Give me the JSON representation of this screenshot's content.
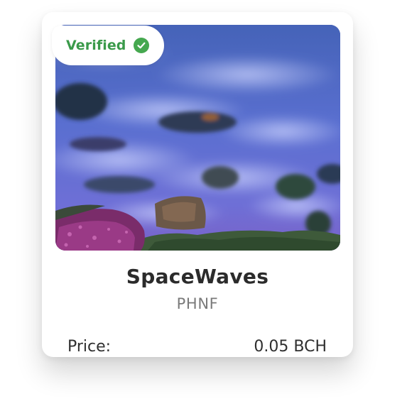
{
  "nft_card": {
    "badge": {
      "label": "Verified",
      "icon": "check-circle-icon",
      "color": "#45a84f"
    },
    "image": {
      "subject": "long-exposure surf over rocks, violet-blue tones"
    },
    "name": "SpaceWaves",
    "symbol": "PHNF",
    "price_label": "Price:",
    "price_value": "0.05 BCH"
  }
}
